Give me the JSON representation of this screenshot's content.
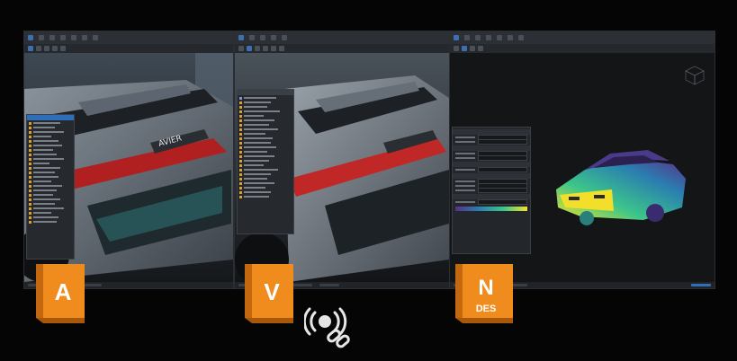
{
  "apps": [
    {
      "id": "alias",
      "letter": "A",
      "color": "#f08c1e"
    },
    {
      "id": "vred",
      "letter": "V",
      "color": "#f08c1e"
    },
    {
      "id": "nastran",
      "letter": "N",
      "sub": "DES",
      "color": "#f08c1e"
    }
  ],
  "link_icon": "link-broadcast-icon",
  "car_badge": "AVIER"
}
